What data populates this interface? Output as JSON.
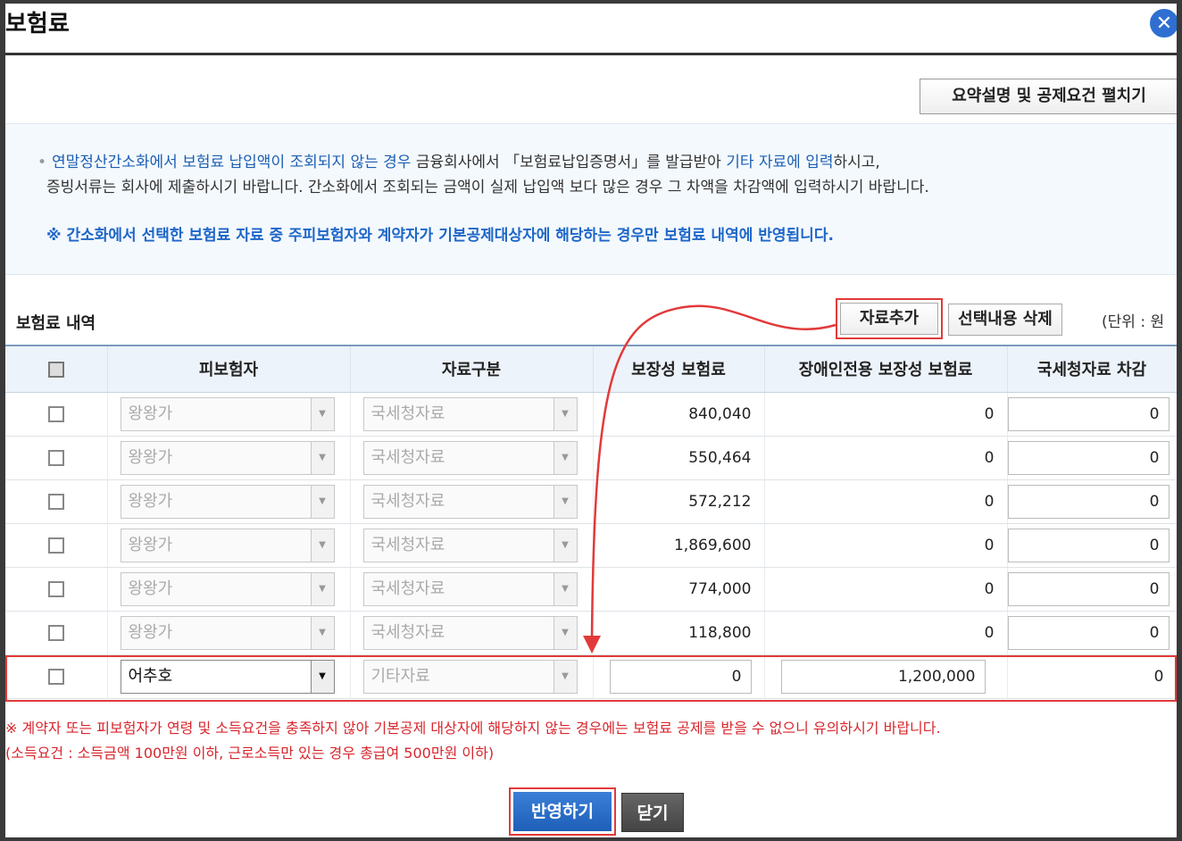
{
  "window": {
    "title": "보험료",
    "close_icon": "✕"
  },
  "summary_button": "요약설명 및 공제요건 펼치기",
  "info": {
    "line1_blue_a": "연말정산간소화에서 보험료 납입액이 조회되지 않는 경우",
    "line1_b": " 금융회사에서 「보험료납입증명서」를 발급받아 ",
    "line1_blue_c": "기타 자료에 입력",
    "line1_d": "하시고,",
    "line2": "증빙서류는 회사에 제출하시기 바랍니다. 간소화에서 조회되는 금액이 실제 납입액 보다 많은 경우 그 차액을 차감액에 입력하시기 바랍니다.",
    "notice": "※ 간소화에서 선택한 보험료 자료 중 주피보험자와 계약자가 기본공제대상자에 해당하는 경우만 보험료 내역에 반영됩니다."
  },
  "section": {
    "title": "보험료 내역",
    "add_button": "자료추가",
    "delete_button": "선택내용 삭제",
    "unit": "(단위 : 원"
  },
  "table": {
    "headers": [
      "피보험자",
      "자료구분",
      "보장성 보험료",
      "장애인전용 보장성 보험료",
      "국세청자료 차감"
    ],
    "rows": [
      {
        "insured": "왕왕가",
        "type": "국세청자료",
        "premium": "840,040",
        "disabled": "0",
        "deduct": "0"
      },
      {
        "insured": "왕왕가",
        "type": "국세청자료",
        "premium": "550,464",
        "disabled": "0",
        "deduct": "0"
      },
      {
        "insured": "왕왕가",
        "type": "국세청자료",
        "premium": "572,212",
        "disabled": "0",
        "deduct": "0"
      },
      {
        "insured": "왕왕가",
        "type": "국세청자료",
        "premium": "1,869,600",
        "disabled": "0",
        "deduct": "0"
      },
      {
        "insured": "왕왕가",
        "type": "국세청자료",
        "premium": "774,000",
        "disabled": "0",
        "deduct": "0"
      },
      {
        "insured": "왕왕가",
        "type": "국세청자료",
        "premium": "118,800",
        "disabled": "0",
        "deduct": "0"
      }
    ],
    "new_row": {
      "insured": "어추호",
      "type": "기타자료",
      "premium": "0",
      "disabled": "1,200,000",
      "deduct": "0"
    }
  },
  "warnings": {
    "line1": "※ 계약자 또는 피보험자가 연령 및 소득요건을 충족하지 않아 기본공제 대상자에 해당하지 않는 경우에는 보험료 공제를 받을 수 없으니 유의하시기 바랍니다.",
    "line2": "(소득요건 : 소득금액 100만원 이하, 근로소득만 있는 경우 총급여 500만원 이하)"
  },
  "buttons": {
    "apply": "반영하기",
    "close": "닫기"
  },
  "colors": {
    "accent_blue": "#1e66c8",
    "annotation_red": "#e23a3a",
    "warning_red": "#d8262d"
  }
}
